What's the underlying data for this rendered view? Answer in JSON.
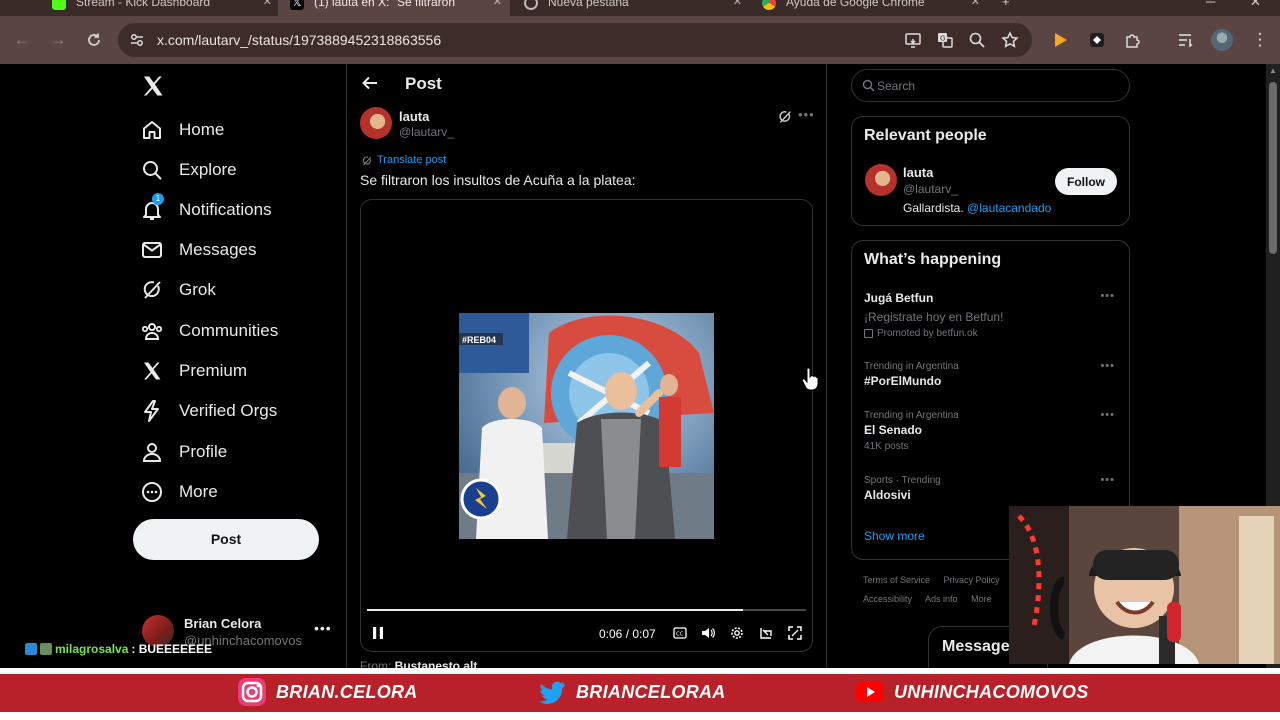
{
  "browser": {
    "tabs": [
      {
        "title": "Stream - Kick Dashboard",
        "active": false
      },
      {
        "title": "(1) lauta en X: \"Se filtraron",
        "active": true
      },
      {
        "title": "Nueva pestaña",
        "active": false
      },
      {
        "title": "Ayuda de Google Chrome",
        "active": false
      }
    ],
    "url": "x.com/lautarv_/status/1973889452318863556"
  },
  "nav": {
    "items": [
      {
        "label": "Home",
        "icon": "home-icon"
      },
      {
        "label": "Explore",
        "icon": "search-icon"
      },
      {
        "label": "Notifications",
        "icon": "bell-icon",
        "badge": "1"
      },
      {
        "label": "Messages",
        "icon": "envelope-icon"
      },
      {
        "label": "Grok",
        "icon": "grok-icon"
      },
      {
        "label": "Communities",
        "icon": "people-icon"
      },
      {
        "label": "Premium",
        "icon": "x-logo-icon"
      },
      {
        "label": "Verified Orgs",
        "icon": "lightning-icon"
      },
      {
        "label": "Profile",
        "icon": "person-icon"
      },
      {
        "label": "More",
        "icon": "more-circle-icon"
      }
    ],
    "post_button": "Post",
    "account": {
      "name": "Brian Celora",
      "handle": "@unhinchacomovos"
    }
  },
  "post": {
    "header_title": "Post",
    "author": {
      "name": "lauta",
      "handle": "@lautarv_"
    },
    "translate_label": "Translate post",
    "text": "Se filtraron los insultos de Acuña a la platea:",
    "video": {
      "overlay_text": "#REB04",
      "time": "0:06 / 0:07",
      "progress": 0.857
    },
    "from_label": "From",
    "from_source": "Bustanesto.alt"
  },
  "right": {
    "search_placeholder": "Search",
    "relevant_people": {
      "title": "Relevant people",
      "name": "lauta",
      "handle": "@lautarv_",
      "bio": "Gallardista.",
      "bio_mention": "@lautacandado",
      "follow_label": "Follow"
    },
    "whats_happening": {
      "title": "What’s happening",
      "trends": [
        {
          "title": "Jugá Betfun",
          "sub": "¡Registrate hoy en Betfun!",
          "promo": "Promoted by betfun.ok",
          "ctx": ""
        },
        {
          "ctx": "Trending in Argentina",
          "title": "#PorElMundo",
          "sub": ""
        },
        {
          "ctx": "Trending in Argentina",
          "title": "El Senado",
          "sub": "41K posts"
        },
        {
          "ctx": "Sports · Trending",
          "title": "Aldosivi",
          "sub": ""
        }
      ],
      "show_more": "Show more"
    },
    "footer_links_row1": [
      "Terms of Service",
      "Privacy Policy"
    ],
    "footer_links_row2": [
      "Accessibility",
      "Ads info",
      "More"
    ],
    "messages_drawer": "Message"
  },
  "stream": {
    "chat_user": "milagrosalva",
    "chat_message": ": BUEEEEEEE",
    "socials": [
      {
        "label": "BRIAN.CELORA",
        "icon": "instagram-icon"
      },
      {
        "label": "BRIANCELORAA",
        "icon": "twitter-icon"
      },
      {
        "label": "UNHINCHACOMOVOS",
        "icon": "youtube-icon"
      }
    ]
  },
  "colors": {
    "accent": "#1d9bf0",
    "chrome_frame": "#5b4543",
    "social_stripe": "#b9212a",
    "chat_user": "#79e34a"
  }
}
